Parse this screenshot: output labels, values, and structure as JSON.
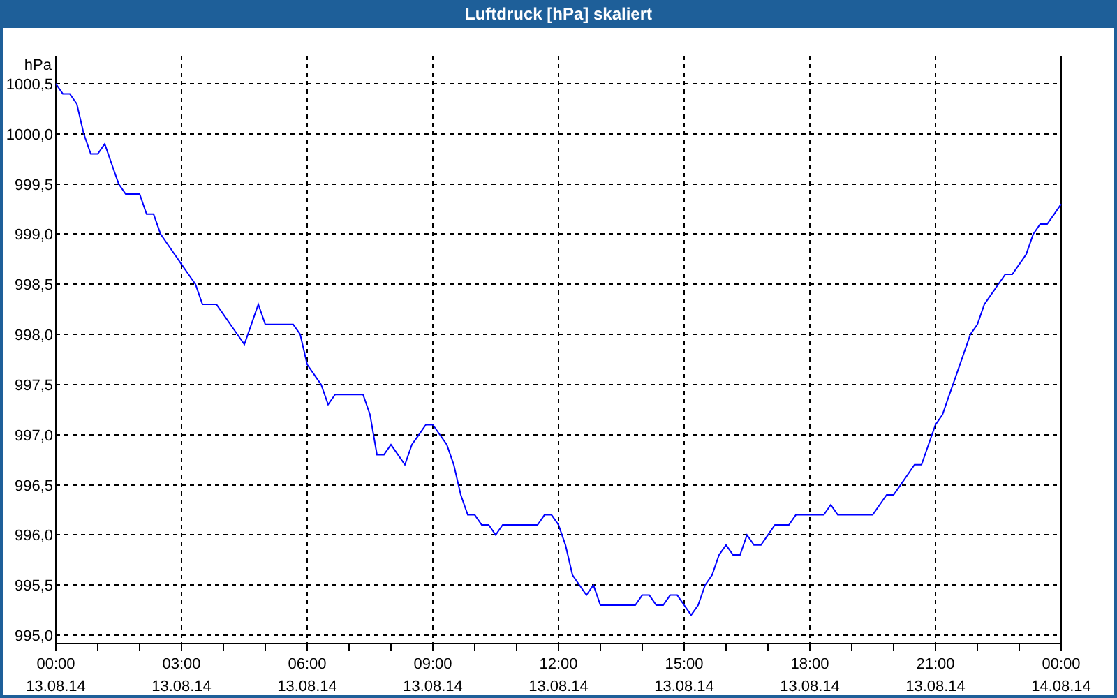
{
  "chart_data": {
    "type": "line",
    "title": "Luftdruck [hPa] skaliert",
    "ylabel": "hPa",
    "categories": [
      "00:00 13.08.14",
      null,
      null,
      null,
      null,
      null,
      null,
      null,
      null,
      null,
      null,
      null,
      null,
      null,
      null,
      null,
      null,
      null,
      "03:00 13.08.14",
      null,
      null,
      null,
      null,
      null,
      null,
      null,
      null,
      null,
      null,
      null,
      null,
      null,
      null,
      null,
      null,
      null,
      "06:00 13.08.14",
      null,
      null,
      null,
      null,
      null,
      null,
      null,
      null,
      null,
      null,
      null,
      null,
      null,
      null,
      null,
      null,
      null,
      "09:00 13.08.14",
      null,
      null,
      null,
      null,
      null,
      null,
      null,
      null,
      null,
      null,
      null,
      null,
      null,
      null,
      null,
      null,
      null,
      "12:00 13.08.14",
      null,
      null,
      null,
      null,
      null,
      null,
      null,
      null,
      null,
      null,
      null,
      null,
      null,
      null,
      null,
      null,
      null,
      "15:00 13.08.14",
      null,
      null,
      null,
      null,
      null,
      null,
      null,
      null,
      null,
      null,
      null,
      null,
      null,
      null,
      null,
      null,
      null,
      "18:00 13.08.14",
      null,
      null,
      null,
      null,
      null,
      null,
      null,
      null,
      null,
      null,
      null,
      null,
      null,
      null,
      null,
      null,
      null,
      "21:00 13.08.14",
      null,
      null,
      null,
      null,
      null,
      null,
      null,
      null,
      null,
      null,
      null,
      null,
      null,
      null,
      null,
      null,
      null,
      "00:00 14.08.14"
    ],
    "series": [
      {
        "color": "#0000ff",
        "values": [
          1000.5,
          1000.4,
          1000.4,
          1000.3,
          1000.0,
          999.8,
          999.8,
          999.9,
          999.7,
          999.5,
          999.4,
          999.4,
          999.4,
          999.2,
          999.2,
          999.0,
          998.9,
          998.8,
          998.7,
          998.6,
          998.5,
          998.3,
          998.3,
          998.3,
          998.2,
          998.1,
          998.0,
          997.9,
          998.1,
          998.3,
          998.1,
          998.1,
          998.1,
          998.1,
          998.1,
          998.0,
          997.7,
          997.6,
          997.5,
          997.3,
          997.4,
          997.4,
          997.4,
          997.4,
          997.4,
          997.2,
          996.8,
          996.8,
          996.9,
          996.8,
          996.7,
          996.9,
          997.0,
          997.1,
          997.1,
          997.0,
          996.9,
          996.7,
          996.4,
          996.2,
          996.2,
          996.1,
          996.1,
          996.0,
          996.1,
          996.1,
          996.1,
          996.1,
          996.1,
          996.1,
          996.2,
          996.2,
          996.1,
          995.9,
          995.6,
          995.5,
          995.4,
          995.5,
          995.3,
          995.3,
          995.3,
          995.3,
          995.3,
          995.3,
          995.4,
          995.4,
          995.3,
          995.3,
          995.4,
          995.4,
          995.3,
          995.2,
          995.3,
          995.5,
          995.6,
          995.8,
          995.9,
          995.8,
          995.8,
          996.0,
          995.9,
          995.9,
          996.0,
          996.1,
          996.1,
          996.1,
          996.2,
          996.2,
          996.2,
          996.2,
          996.2,
          996.3,
          996.2,
          996.2,
          996.2,
          996.2,
          996.2,
          996.2,
          996.3,
          996.4,
          996.4,
          996.5,
          996.6,
          996.7,
          996.7,
          996.9,
          997.1,
          997.2,
          997.4,
          997.6,
          997.8,
          998.0,
          998.1,
          998.3,
          998.4,
          998.5,
          998.6,
          998.6,
          998.7,
          998.8,
          999.0,
          999.1,
          999.1,
          999.2,
          999.3
        ]
      }
    ],
    "grid": true,
    "ylim": [
      995.0,
      1000.5
    ],
    "yticks": [
      {
        "value": 995.0,
        "label": "995,0"
      },
      {
        "value": 995.5,
        "label": "995,5"
      },
      {
        "value": 996.0,
        "label": "996,0"
      },
      {
        "value": 996.5,
        "label": "996,5"
      },
      {
        "value": 997.0,
        "label": "997,0"
      },
      {
        "value": 997.5,
        "label": "997,5"
      },
      {
        "value": 998.0,
        "label": "998,0"
      },
      {
        "value": 998.5,
        "label": "998,5"
      },
      {
        "value": 999.0,
        "label": "999,0"
      },
      {
        "value": 999.5,
        "label": "999,5"
      },
      {
        "value": 1000.0,
        "label": "1000,0"
      },
      {
        "value": 1000.5,
        "label": "1000,5"
      }
    ]
  }
}
